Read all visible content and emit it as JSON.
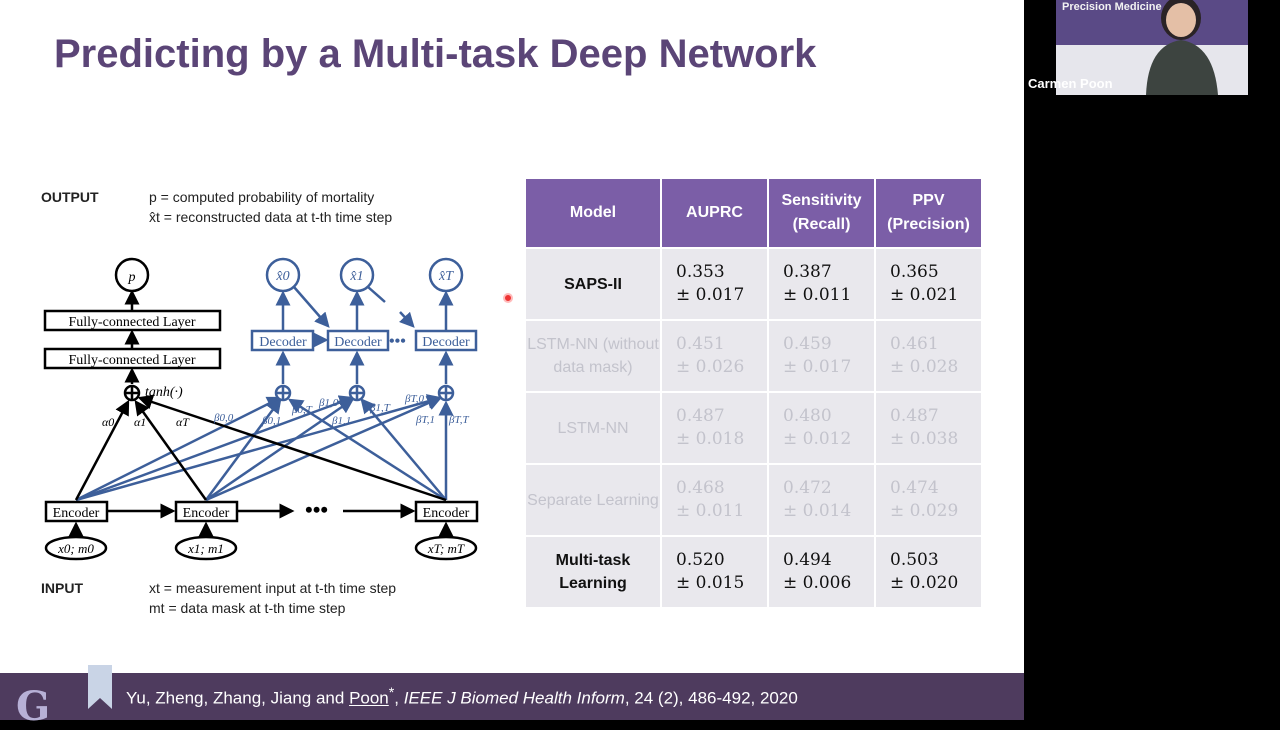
{
  "slide": {
    "title": "Predicting by a Multi-task Deep Network",
    "output_label": "OUTPUT",
    "output_lines": [
      "p = computed probability of mortality",
      "x̂t = reconstructed data at t-th time step"
    ],
    "input_label": "INPUT",
    "input_lines": [
      "xt = measurement input at t-th time step",
      "mt = data mask at t-th time step"
    ],
    "diagram": {
      "p": "p",
      "fc1": "Fully-connected Layer",
      "fc2": "Fully-connected Layer",
      "tanh": "tanh(·)",
      "encoder": "Encoder",
      "decoder": "Decoder",
      "inputs": [
        "x0; m0",
        "x1; m1",
        "xT; mT"
      ],
      "xhat": [
        "x̂0",
        "x̂1",
        "x̂T"
      ],
      "alphas": [
        "α0",
        "α1",
        "αT"
      ],
      "betas": [
        "β0,0",
        "β0,1",
        "β0,T",
        "β1,0",
        "β1,1",
        "β1,T",
        "βT,0",
        "βT,1",
        "βT,T"
      ],
      "colors": {
        "encoder_path": "#000000",
        "decoder_path": "#3d5f9a"
      }
    },
    "table": {
      "headers": [
        "Model",
        "AUPRC",
        "Sensitivity (Recall)",
        "PPV (Precision)"
      ],
      "rows": [
        {
          "model": "SAPS-II",
          "auprc": [
            "0.353",
            "± 0.017"
          ],
          "sens": [
            "0.387",
            "± 0.011"
          ],
          "ppv": [
            "0.365",
            "± 0.021"
          ],
          "style": "bold"
        },
        {
          "model": "LSTM-NN (without data mask)",
          "auprc": [
            "0.451",
            "± 0.026"
          ],
          "sens": [
            "0.459",
            "± 0.017"
          ],
          "ppv": [
            "0.461",
            "± 0.028"
          ],
          "style": "dim"
        },
        {
          "model": "LSTM-NN",
          "auprc": [
            "0.487",
            "± 0.018"
          ],
          "sens": [
            "0.480",
            "± 0.012"
          ],
          "ppv": [
            "0.487",
            "± 0.038"
          ],
          "style": "dim"
        },
        {
          "model": "Separate Learning",
          "auprc": [
            "0.468",
            "± 0.011"
          ],
          "sens": [
            "0.472",
            "± 0.014"
          ],
          "ppv": [
            "0.474",
            "± 0.029"
          ],
          "style": "dim"
        },
        {
          "model": "Multi-task Learning",
          "auprc": [
            "0.520",
            "± 0.015"
          ],
          "sens": [
            "0.494",
            "± 0.006"
          ],
          "ppv": [
            "0.503",
            "± 0.020"
          ],
          "style": "bold"
        }
      ],
      "header_color": "#7b5ea7"
    },
    "footer": {
      "authors": "Yu, Zheng, Zhang, Jiang and ",
      "poon": "Poon",
      "star": "*",
      "sep": ", ",
      "journal": "IEEE J Biomed Health Inform",
      "rest": ", 24 (2), 486-492, 2020",
      "logo": "G"
    }
  },
  "video": {
    "participant_name": "Carmen Poon",
    "background_text": "Precision Medicine"
  }
}
